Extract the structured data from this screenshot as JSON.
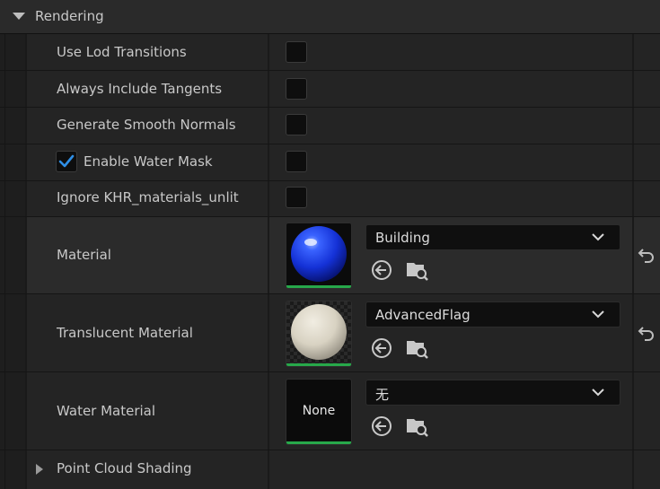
{
  "section": {
    "title": "Rendering"
  },
  "rows": {
    "lod": {
      "label": "Use Lod Transitions"
    },
    "tangents": {
      "label": "Always Include Tangents"
    },
    "normals": {
      "label": "Generate Smooth Normals"
    },
    "water_mask": {
      "label": "Enable Water Mask",
      "checked": true
    },
    "khr": {
      "label": "Ignore KHR_materials_unlit"
    }
  },
  "materials": {
    "material": {
      "label": "Material",
      "value": "Building",
      "preview": "blue-sphere"
    },
    "translucent": {
      "label": "Translucent Material",
      "value": "AdvancedFlag",
      "preview": "white-sphere"
    },
    "water": {
      "label": "Water Material",
      "value": "无",
      "thumb_text": "None"
    }
  },
  "subsection": {
    "title": "Point Cloud Shading"
  },
  "colors": {
    "accent_check": "#2f8fe6",
    "thumb_bar": "#27a84a"
  }
}
